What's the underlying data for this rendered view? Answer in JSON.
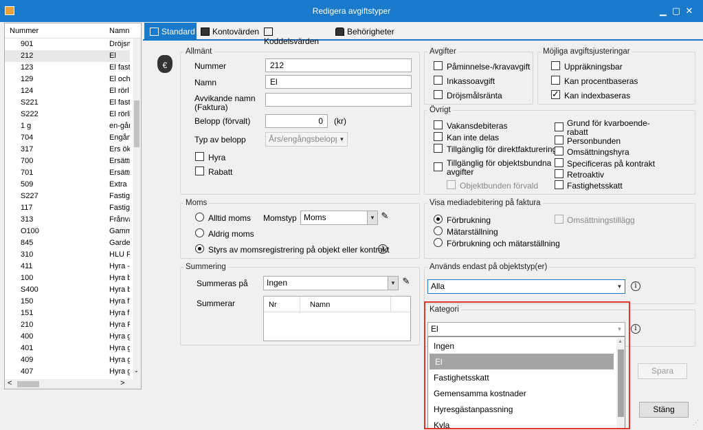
{
  "window": {
    "title": "Redigera avgiftstyper",
    "minimize": "▁",
    "maximize": "▢",
    "close": "✕"
  },
  "list": {
    "col_number": "Nummer",
    "col_name": "Namn",
    "rows": [
      {
        "n": "901",
        "m": "Dröjsm"
      },
      {
        "n": "212",
        "m": "El"
      },
      {
        "n": "123",
        "m": "El fast"
      },
      {
        "n": "129",
        "m": "El och"
      },
      {
        "n": "124",
        "m": "El rörl"
      },
      {
        "n": "S221",
        "m": "El fast"
      },
      {
        "n": "S222",
        "m": "El rörli"
      },
      {
        "n": "1 g",
        "m": "en-gån"
      },
      {
        "n": "704",
        "m": "Engån"
      },
      {
        "n": "317",
        "m": "Ers ök"
      },
      {
        "n": "700",
        "m": "Ersättn"
      },
      {
        "n": "701",
        "m": "Ersättn"
      },
      {
        "n": "509",
        "m": "Extra"
      },
      {
        "n": "S227",
        "m": "Fastig"
      },
      {
        "n": "117",
        "m": "Fastig"
      },
      {
        "n": "313",
        "m": "Frånva"
      },
      {
        "n": "O100",
        "m": "Gamm"
      },
      {
        "n": "845",
        "m": "Garde"
      },
      {
        "n": "310",
        "m": "HLU F"
      },
      {
        "n": "411",
        "m": "Hyra -"
      },
      {
        "n": "100",
        "m": "Hyra b"
      },
      {
        "n": "S400",
        "m": "Hyra b"
      },
      {
        "n": "150",
        "m": "Hyra f"
      },
      {
        "n": "151",
        "m": "Hyra f"
      },
      {
        "n": "210",
        "m": "Hyra F"
      },
      {
        "n": "400",
        "m": "Hyra g"
      },
      {
        "n": "401",
        "m": "Hyra g"
      },
      {
        "n": "409",
        "m": "Hyra g"
      },
      {
        "n": "407",
        "m": "Hyra g"
      }
    ],
    "scroll_left": "<",
    "scroll_right": ">"
  },
  "tabs": {
    "standard": "Standard",
    "kontovarden": "Kontovärden",
    "koddelsvarden": "Koddelsvärden",
    "behorigheter": "Behörigheter"
  },
  "allmant": {
    "legend": "Allmänt",
    "nummer_label": "Nummer",
    "nummer_value": "212",
    "namn_label": "Namn",
    "namn_value": "El",
    "avvikande_label_1": "Avvikande namn",
    "avvikande_label_2": "(Faktura)",
    "avvikande_value": "",
    "belopp_label": "Belopp (förvalt)",
    "belopp_value": "0",
    "belopp_unit": "(kr)",
    "typ_label": "Typ av belopp",
    "typ_value": "Års/engångsbelopp",
    "hyra": "Hyra",
    "rabatt": "Rabatt"
  },
  "avgifter": {
    "legend": "Avgifter",
    "items": [
      "Påminnelse-/kravavgift",
      "Inkassoavgift",
      "Dröjsmålsränta"
    ]
  },
  "justeringar": {
    "legend": "Möjliga avgiftsjusteringar",
    "items": [
      "Uppräkningsbar",
      "Kan procentbaseras",
      "Kan indexbaseras"
    ]
  },
  "ovrigt": {
    "legend": "Övrigt",
    "left": [
      "Vakansdebiteras",
      "Kan inte delas",
      "Tillgänglig för direktfakturering"
    ],
    "obj_1": "Tillgänglig för objektsbundna",
    "obj_2": "avgifter",
    "objbunden": "Objektbunden förvald",
    "right_grund_1": "Grund för kvarboende-",
    "right_grund_2": "rabatt",
    "right": [
      "Personbunden",
      "Omsättningshyra",
      "Specificeras på kontrakt",
      "Retroaktiv",
      "Fastighetsskatt"
    ]
  },
  "moms": {
    "legend": "Moms",
    "alltid": "Alltid moms",
    "aldrig": "Aldrig moms",
    "styrs": "Styrs av momsregistrering på objekt eller kontrakt",
    "momstyp_label": "Momstyp",
    "momstyp_value": "Moms"
  },
  "media": {
    "legend": "Visa mediadebitering på faktura",
    "forbrukning": "Förbrukning",
    "matarstallning": "Mätarställning",
    "bada": "Förbrukning och mätarställning",
    "omsattning": "Omsättningstillägg"
  },
  "summering": {
    "legend": "Summering",
    "summeras_label": "Summeras på",
    "summeras_value": "Ingen",
    "summerar_label": "Summerar",
    "col_nr": "Nr",
    "col_namn": "Namn"
  },
  "objektstyp": {
    "legend": "Används endast på objektstyp(er)",
    "value": "Alla"
  },
  "kategori": {
    "legend": "Kategori",
    "value": "El",
    "options": [
      "Ingen",
      "El",
      "Fastighetsskatt",
      "Gemensamma kostnader",
      "Hyresgästanpassning",
      "Kyla"
    ]
  },
  "buttons": {
    "spara": "Spara",
    "stang": "Stäng"
  },
  "icons": {
    "info": "i",
    "edit": "✎",
    "money": "€"
  }
}
